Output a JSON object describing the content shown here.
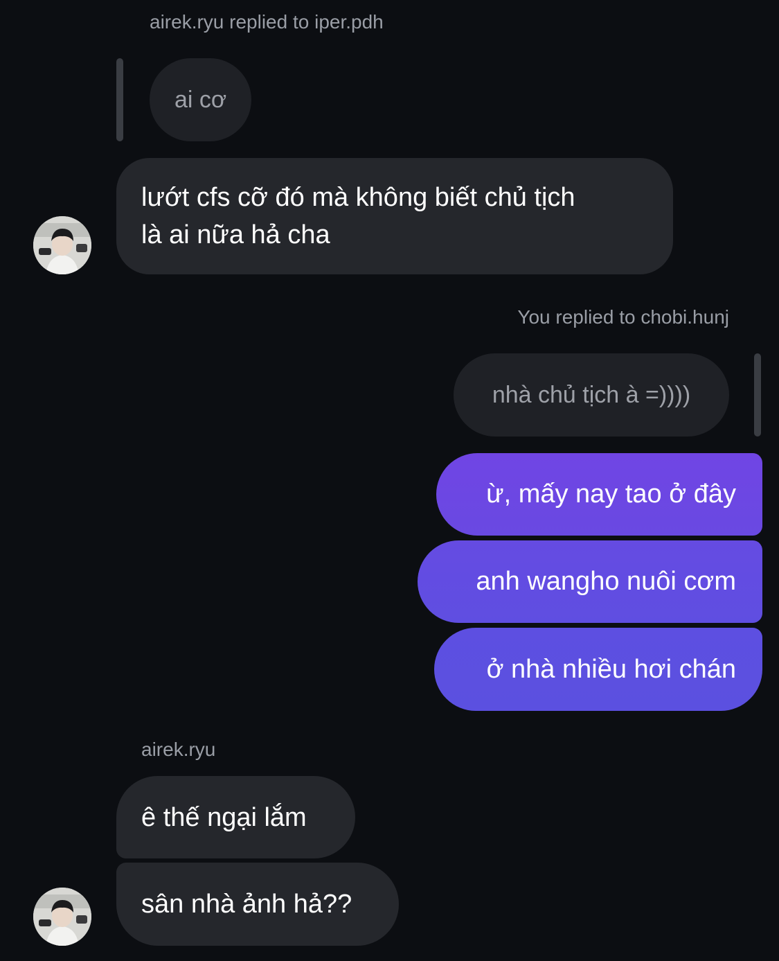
{
  "thread": {
    "reply_header_1": "airek.ryu replied to iper.pdh",
    "quoted_1": "ai cơ",
    "incoming_1_line1": "lướt cfs cỡ đó mà không biết chủ tịch",
    "incoming_1_line2": "là ai nữa hả cha",
    "reply_header_2": "You replied to chobi.hunj",
    "quoted_2": "nhà chủ tịch à =))))",
    "outgoing": [
      "ừ, mấy nay tao ở đây",
      "anh wangho nuôi cơm",
      "ở nhà nhiều hơi chán"
    ],
    "sender_label": "airek.ryu",
    "incoming_2": "ê thế ngại lắm",
    "incoming_3": "sân nhà ảnh hả??"
  },
  "colors": {
    "background": "#0c0e12",
    "incoming_bubble": "#25272c",
    "quoted_bubble": "#1f2126",
    "outgoing_gradient_top": "#6f46e3",
    "outgoing_gradient_bottom": "#5c4fe0",
    "meta_text": "#9a9ea6"
  }
}
